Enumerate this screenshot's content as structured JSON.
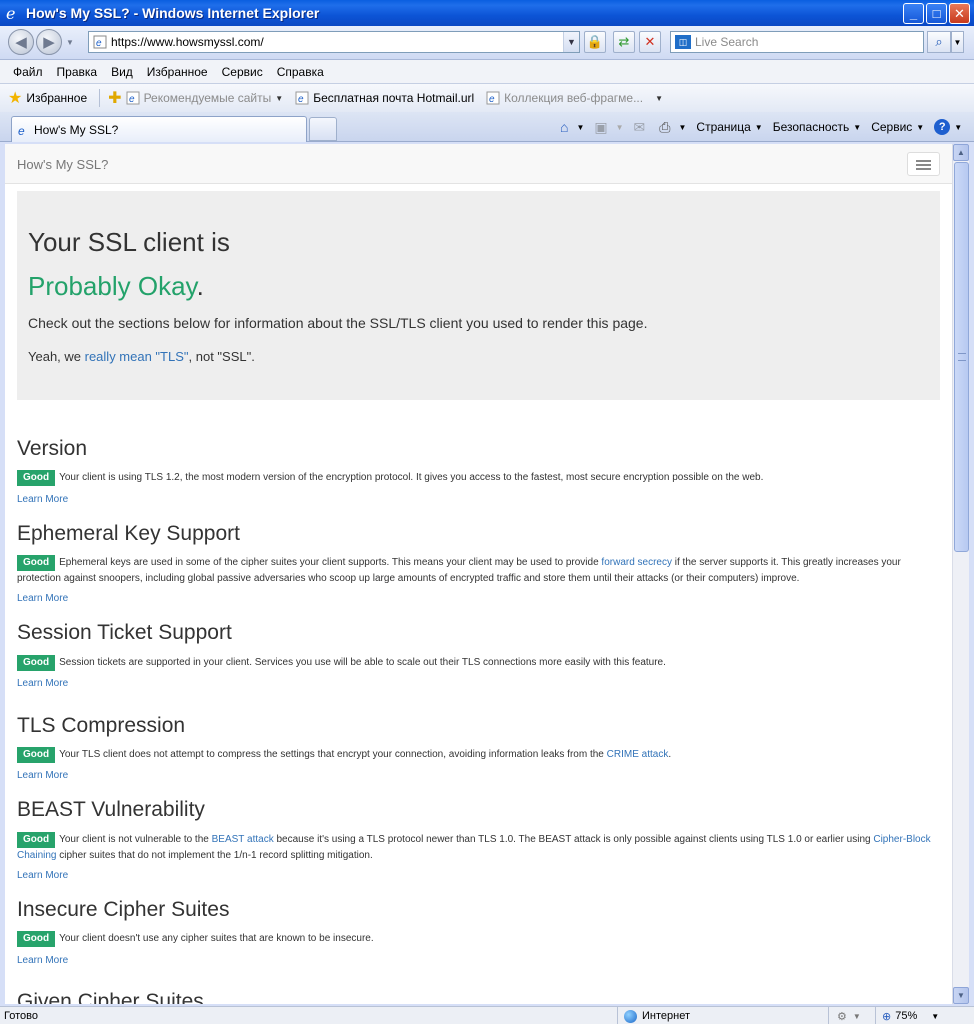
{
  "window": {
    "title": "How's My SSL? - Windows Internet Explorer",
    "minimize": "_",
    "maximize": "□",
    "close": "✕"
  },
  "address": {
    "url": "https://www.howsmyssl.com/"
  },
  "search": {
    "placeholder": "Live Search"
  },
  "menu": [
    "Файл",
    "Правка",
    "Вид",
    "Избранное",
    "Сервис",
    "Справка"
  ],
  "favorites": {
    "label": "Избранное",
    "items": [
      {
        "label": "Рекомендуемые сайты"
      },
      {
        "label": "Бесплатная почта Hotmail.url"
      },
      {
        "label": "Коллекция веб-фрагме..."
      }
    ]
  },
  "tab": {
    "label": "How's My SSL?"
  },
  "commands": {
    "page": "Страница",
    "security": "Безопасность",
    "tools": "Сервис",
    "help": "?"
  },
  "site": {
    "brand": "How's My SSL?",
    "jumbo": {
      "heading": "Your SSL client is",
      "rating": "Probably Okay",
      "rating_dot": ".",
      "intro": "Check out the sections below for information about the SSL/TLS client you used to render this page.",
      "tls_prefix": "Yeah, we ",
      "tls_link": "really mean \"TLS\"",
      "tls_suffix": ", not \"SSL\"."
    },
    "learn_more": "Learn More",
    "badge": "Good",
    "sections": [
      {
        "title": "Version",
        "text": "Your client is using TLS 1.2, the most modern version of the encryption protocol. It gives you access to the fastest, most secure encryption possible on the web."
      },
      {
        "title": "Ephemeral Key Support",
        "text_a": "Ephemeral keys are used in some of the cipher suites your client supports. This means your client may be used to provide ",
        "link": "forward secrecy",
        "text_b": " if the server supports it. This greatly increases your protection against snoopers, including global passive adversaries who scoop up large amounts of encrypted traffic and store them until their attacks (or their computers) improve."
      },
      {
        "title": "Session Ticket Support",
        "text": "Session tickets are supported in your client. Services you use will be able to scale out their TLS connections more easily with this feature."
      },
      {
        "title": "TLS Compression",
        "text_a": "Your TLS client does not attempt to compress the settings that encrypt your connection, avoiding information leaks from the ",
        "link": "CRIME attack",
        "text_b": "."
      },
      {
        "title": "BEAST Vulnerability",
        "text_a": "Your client is not vulnerable to the ",
        "link": "BEAST attack",
        "text_b": " because it's using a TLS protocol newer than TLS 1.0. The BEAST attack is only possible against clients using TLS 1.0 or earlier using ",
        "link2": "Cipher-Block Chaining",
        "text_c": " cipher suites that do not implement the 1/n-1 record splitting mitigation."
      },
      {
        "title": "Insecure Cipher Suites",
        "text": "Your client doesn't use any cipher suites that are known to be insecure."
      },
      {
        "title": "Given Cipher Suites"
      }
    ]
  },
  "status": {
    "ready": "Готово",
    "zone": "Интернет",
    "zoom": "75%"
  },
  "colors": {
    "good_badge": "#27a36b",
    "rating_green": "#23a26a",
    "link_blue": "#3273b8"
  },
  "icons": [
    "ie-logo-icon",
    "back-icon",
    "forward-icon",
    "lock-icon",
    "refresh-icon",
    "stop-icon",
    "search-icon",
    "star-icon",
    "home-icon",
    "feeds-icon",
    "mail-icon",
    "print-icon",
    "help-icon",
    "hamburger-icon",
    "globe-icon"
  ]
}
